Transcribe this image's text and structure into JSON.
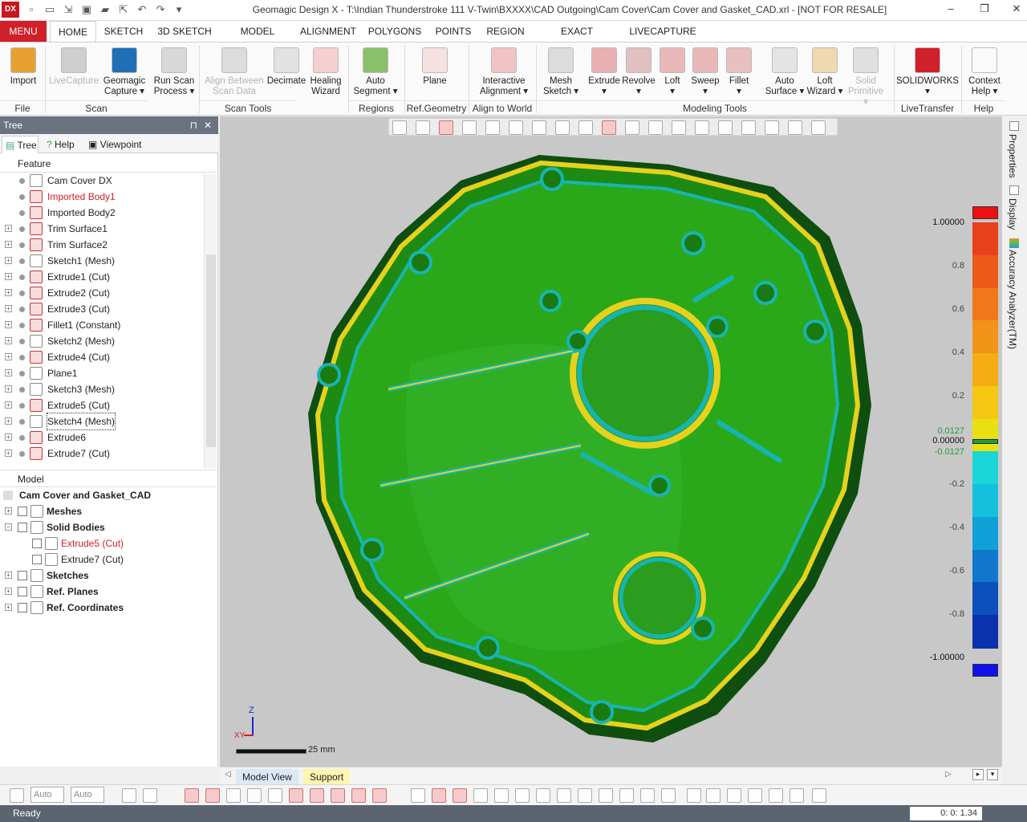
{
  "app": {
    "logo": "DX",
    "title": "Geomagic Design X - T:\\Indian Thunderstroke 111 V-Twin\\BXXXX\\CAD Outgoing\\Cam Cover\\Cam Cover and Gasket_CAD.xrl - [NOT FOR RESALE]"
  },
  "quick_access": [
    "new-icon",
    "open-icon",
    "import-icon",
    "save-icon",
    "open-folder-icon",
    "export-icon",
    "undo-icon",
    "redo-icon",
    "qa-menu-icon"
  ],
  "window_controls": {
    "minimize": "–",
    "restore": "❐",
    "close": "✕"
  },
  "ribbon_tabs": {
    "menu": "MENU",
    "tabs": [
      "HOME",
      "SKETCH",
      "3D SKETCH",
      "MODEL",
      "ALIGNMENT",
      "POLYGONS",
      "POINTS",
      "REGION",
      "EXACT SURFACING",
      "LIVECAPTURE"
    ],
    "active": "HOME"
  },
  "ribbon": {
    "buttons": [
      {
        "l1": "Import",
        "l2": "",
        "disabled": false,
        "icon": "import-icon",
        "color": "#e8a030"
      },
      {
        "l1": "LiveCapture",
        "l2": "",
        "disabled": true,
        "icon": "livecapture-icon",
        "color": "#cfcfcf"
      },
      {
        "l1": "Geomagic",
        "l2": "Capture ▾",
        "disabled": false,
        "icon": "geomagic-capture-icon",
        "color": "#1e6fb5"
      },
      {
        "l1": "Run Scan",
        "l2": "Process ▾",
        "disabled": false,
        "icon": "run-scan-icon",
        "color": "#d8d8d8"
      },
      {
        "l1": "Align Between",
        "l2": "Scan Data",
        "disabled": true,
        "icon": "align-scan-icon",
        "color": "#dcdcdc"
      },
      {
        "l1": "Decimate",
        "l2": "",
        "disabled": false,
        "icon": "decimate-icon",
        "color": "#e2e2e2"
      },
      {
        "l1": "Healing",
        "l2": "Wizard",
        "disabled": false,
        "icon": "healing-wizard-icon",
        "color": "#f4d0d0"
      },
      {
        "l1": "Auto",
        "l2": "Segment ▾",
        "disabled": false,
        "icon": "auto-segment-icon",
        "color": "#8bc06a"
      },
      {
        "l1": "Plane",
        "l2": "",
        "disabled": false,
        "icon": "plane-icon",
        "color": "#f6e0e0"
      },
      {
        "l1": "Interactive",
        "l2": "Alignment ▾",
        "disabled": false,
        "icon": "interactive-alignment-icon",
        "color": "#f0c4c4"
      },
      {
        "l1": "Mesh",
        "l2": "Sketch ▾",
        "disabled": false,
        "icon": "mesh-sketch-icon",
        "color": "#dcdcdc"
      },
      {
        "l1": "Extrude",
        "l2": "▾",
        "disabled": false,
        "icon": "extrude-icon",
        "color": "#e8b0b0"
      },
      {
        "l1": "Revolve",
        "l2": "▾",
        "disabled": false,
        "icon": "revolve-icon",
        "color": "#e0c0c0"
      },
      {
        "l1": "Loft",
        "l2": "▾",
        "disabled": false,
        "icon": "loft-icon",
        "color": "#e8b8b8"
      },
      {
        "l1": "Sweep",
        "l2": "▾",
        "disabled": false,
        "icon": "sweep-icon",
        "color": "#e8b8b8"
      },
      {
        "l1": "Fillet",
        "l2": "▾",
        "disabled": false,
        "icon": "fillet-icon",
        "color": "#e8c0c0"
      },
      {
        "l1": "Auto",
        "l2": "Surface ▾",
        "disabled": false,
        "icon": "auto-surface-icon",
        "color": "#e4e4e4"
      },
      {
        "l1": "Loft",
        "l2": "Wizard ▾",
        "disabled": false,
        "icon": "loft-wizard-icon",
        "color": "#f0d8b0"
      },
      {
        "l1": "Solid",
        "l2": "Primitive ▾",
        "disabled": true,
        "icon": "solid-primitive-icon",
        "color": "#e0e0e0"
      },
      {
        "l1": "SOLIDWORKS",
        "l2": "▾",
        "disabled": false,
        "icon": "solidworks-icon",
        "color": "#d0202a"
      },
      {
        "l1": "Context",
        "l2": "Help ▾",
        "disabled": false,
        "icon": "context-help-icon",
        "color": "#fafafa"
      }
    ],
    "groups": [
      "File",
      "Scan",
      "Scan Tools",
      "Regions",
      "Ref.Geometry",
      "Align to World",
      "Modeling Tools",
      "LiveTransfer",
      "Help"
    ]
  },
  "tree_panel": {
    "title": "Tree",
    "pin": "⊓",
    "close": "✕",
    "tabs": [
      "Tree",
      "Help",
      "Viewpoint"
    ],
    "feature_header": "Feature",
    "model_header": "Model"
  },
  "features": [
    {
      "label": "Cam Cover DX",
      "expandable": false,
      "red": false,
      "icon": "cam-cover-icon"
    },
    {
      "label": "Imported Body1",
      "expandable": false,
      "red": true,
      "icon": "imported-body-icon"
    },
    {
      "label": "Imported Body2",
      "expandable": false,
      "red": false,
      "icon": "imported-body-icon"
    },
    {
      "label": "Trim Surface1",
      "expandable": true,
      "red": false,
      "icon": "trim-surface-icon"
    },
    {
      "label": "Trim Surface2",
      "expandable": true,
      "red": false,
      "icon": "trim-surface-icon"
    },
    {
      "label": "Sketch1 (Mesh)",
      "expandable": true,
      "red": false,
      "icon": "mesh-sketch-icon"
    },
    {
      "label": "Extrude1 (Cut)",
      "expandable": true,
      "red": false,
      "icon": "extrude-icon"
    },
    {
      "label": "Extrude2 (Cut)",
      "expandable": true,
      "red": false,
      "icon": "extrude-icon"
    },
    {
      "label": "Extrude3 (Cut)",
      "expandable": true,
      "red": false,
      "icon": "extrude-icon"
    },
    {
      "label": "Fillet1 (Constant)",
      "expandable": true,
      "red": false,
      "icon": "fillet-icon"
    },
    {
      "label": "Sketch2 (Mesh)",
      "expandable": true,
      "red": false,
      "icon": "mesh-sketch-icon"
    },
    {
      "label": "Extrude4 (Cut)",
      "expandable": true,
      "red": false,
      "icon": "extrude-icon"
    },
    {
      "label": "Plane1",
      "expandable": true,
      "red": false,
      "icon": "plane-icon"
    },
    {
      "label": "Sketch3 (Mesh)",
      "expandable": true,
      "red": false,
      "icon": "mesh-sketch-icon"
    },
    {
      "label": "Extrude5 (Cut)",
      "expandable": true,
      "red": false,
      "icon": "extrude-icon"
    },
    {
      "label": "Sketch4 (Mesh)",
      "expandable": true,
      "red": false,
      "icon": "mesh-sketch-icon",
      "selected": true
    },
    {
      "label": "Extrude6",
      "expandable": true,
      "red": false,
      "icon": "extrude-icon"
    },
    {
      "label": "Extrude7 (Cut)",
      "expandable": true,
      "red": false,
      "icon": "extrude-icon"
    }
  ],
  "model": [
    {
      "label": "Cam Cover and Gasket_CAD",
      "level": 0,
      "bold": true,
      "red": false,
      "icon": "model-root-icon",
      "expandable": false
    },
    {
      "label": "Meshes",
      "level": 1,
      "bold": true,
      "red": false,
      "icon": "meshes-icon",
      "expandable": true
    },
    {
      "label": "Solid Bodies",
      "level": 1,
      "bold": true,
      "red": false,
      "icon": "solid-bodies-icon",
      "expandable": true
    },
    {
      "label": "Extrude5 (Cut)",
      "level": 2,
      "bold": false,
      "red": true,
      "icon": "solid-body-icon",
      "expandable": false
    },
    {
      "label": "Extrude7 (Cut)",
      "level": 2,
      "bold": false,
      "red": false,
      "icon": "solid-body-icon",
      "expandable": false
    },
    {
      "label": "Sketches",
      "level": 1,
      "bold": true,
      "red": false,
      "icon": "sketches-icon",
      "expandable": true
    },
    {
      "label": "Ref. Planes",
      "level": 1,
      "bold": true,
      "red": false,
      "icon": "ref-planes-icon",
      "expandable": true
    },
    {
      "label": "Ref. Coordinates",
      "level": 1,
      "bold": true,
      "red": false,
      "icon": "ref-coordinates-icon",
      "expandable": true
    }
  ],
  "viewport": {
    "scale_label": "25 mm",
    "axis_z": "Z",
    "axis_xy": "XY"
  },
  "colormap": {
    "ticks": [
      "1.00000",
      "0.8",
      "0.6",
      "0.4",
      "0.2",
      "0.0127",
      "0.00000",
      "-0.0127",
      "-0.2",
      "-0.4",
      "-0.6",
      "-0.8",
      "-1.00000"
    ],
    "colors": [
      "#e8401c",
      "#ee5a18",
      "#f07818",
      "#f29418",
      "#f4ae14",
      "#f4c812",
      "#e8e010",
      "#1ad6d6",
      "#14c0de",
      "#10a0d8",
      "#1078cc",
      "#0c50bc",
      "#0a32ac"
    ],
    "max_color": "#ee1010",
    "min_color": "#1010ee",
    "tolerance_color": "#20a040"
  },
  "right_panel": {
    "tabs": [
      "Properties",
      "Display",
      "Accuracy Analyzer(TM)"
    ]
  },
  "view_tabs": {
    "tabs": [
      "Model View",
      "Support"
    ],
    "active": "Support"
  },
  "bottom_toolbar": {
    "combo1": "Auto",
    "combo2": "Auto"
  },
  "status": {
    "text": "Ready",
    "timer": "0: 0: 1.34"
  }
}
